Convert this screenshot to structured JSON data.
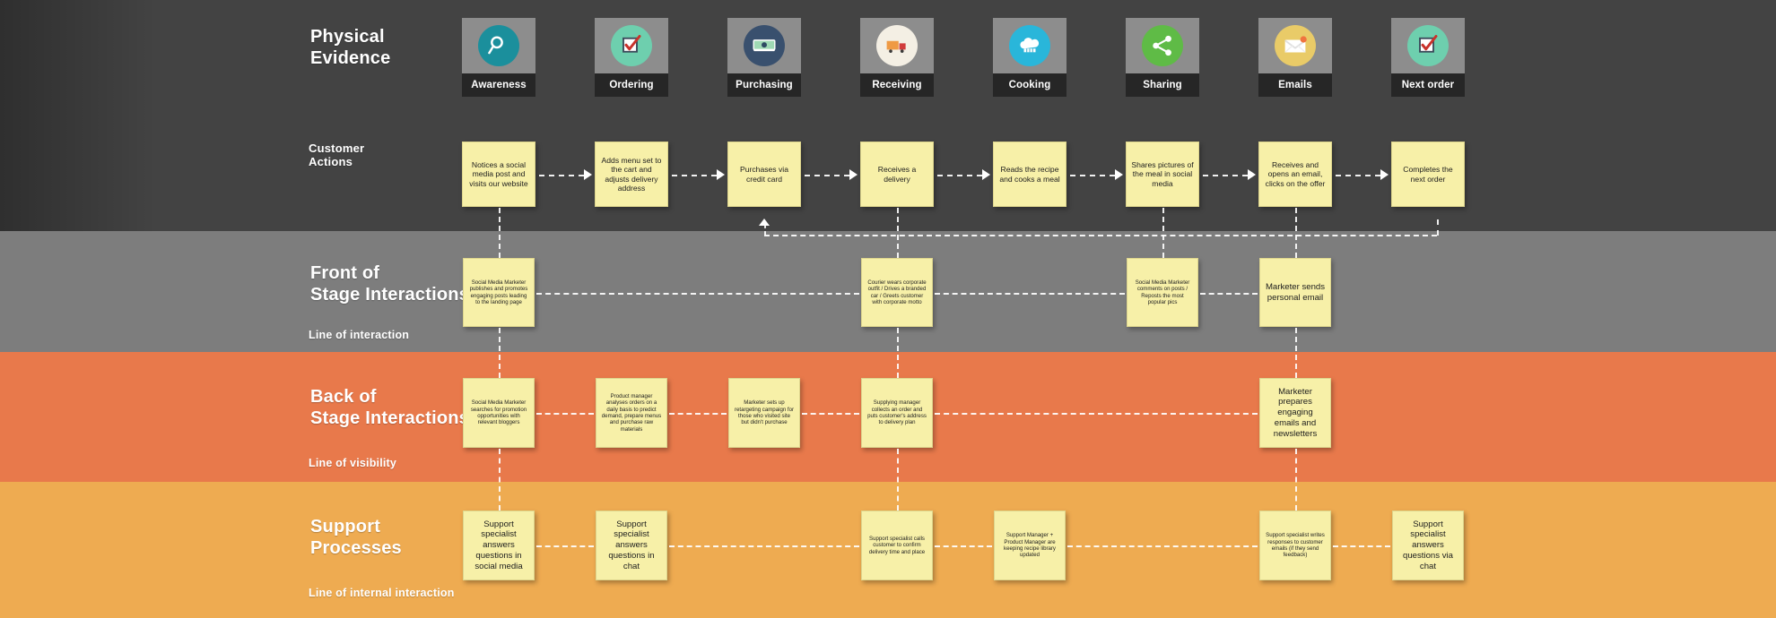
{
  "rows": {
    "physical_evidence": {
      "title": "Physical\nEvidence"
    },
    "customer_actions": {
      "title": "Customer\nActions"
    },
    "front_stage": {
      "title": "Front of\nStage Interactions",
      "line_label": "Line of interaction"
    },
    "back_stage": {
      "title": "Back of\nStage Interactions",
      "line_label": "Line of visibility"
    },
    "support": {
      "title": "Support\nProcesses",
      "line_label": "Line of internal interaction"
    }
  },
  "colors": {
    "band_evidence": "#434343",
    "band_front": "#7d7d7d",
    "band_back": "#e8794b",
    "band_support": "#eeab51",
    "note": "#f7f0a8",
    "icon_tile": "#8d8d8d",
    "label_tile": "#262626"
  },
  "evidence": [
    {
      "label": "Awareness",
      "icon": "magnifier-icon",
      "circle": "#1b8f9c"
    },
    {
      "label": "Ordering",
      "icon": "checkbox-icon",
      "circle": "#6ecfae"
    },
    {
      "label": "Purchasing",
      "icon": "banknote-icon",
      "circle": "#39506e"
    },
    {
      "label": "Receiving",
      "icon": "truck-icon",
      "circle": "#f4efe4"
    },
    {
      "label": "Cooking",
      "icon": "chef-hat-icon",
      "circle": "#29b6da"
    },
    {
      "label": "Sharing",
      "icon": "share-icon",
      "circle": "#5fbb46"
    },
    {
      "label": "Emails",
      "icon": "envelope-icon",
      "circle": "#e9cb68"
    },
    {
      "label": "Next order",
      "icon": "checkbox-icon",
      "circle": "#6ecfae"
    }
  ],
  "customer_actions": [
    "Notices a social media post and visits our website",
    "Adds menu set to the cart and adjusts delivery address",
    "Purchases via credit card",
    "Receives a delivery",
    "Reads the recipe and cooks a meal",
    "Shares pictures of the meal in social media",
    "Receives and opens an email, clicks on the offer",
    "Completes the next order"
  ],
  "front_stage": [
    "Social Media Marketer publishes and promotes engaging posts leading to the landing page",
    "Courier wears corporate outfit / Drives a branded car / Greets customer with corporate motto",
    "Social Media Marketer comments on posts / Reposts the most popular pics",
    "Marketer sends personal email"
  ],
  "back_stage": [
    "Social Media Marketer searches for promotion opportunities with relevant bloggers",
    "Product manager analyses orders on a daily basis to predict demand, prepare menus and purchase raw materials",
    "Marketer sets up retargeting campaign for those who visited site but didn't purchase",
    "Supplying manager collects an order and puts customer's address to delivery plan",
    "Marketer prepares engaging emails and newsletters"
  ],
  "support": [
    "Support specialist answers questions in social media",
    "Support specialist answers questions in chat",
    "Support specialist calls customer to confirm delivery time and place",
    "Support Manager + Product Manager are keeping recipe library updated",
    "Support specialist writes responses to customer emails (if they send feedback)",
    "Support specialist answers questions via chat"
  ]
}
